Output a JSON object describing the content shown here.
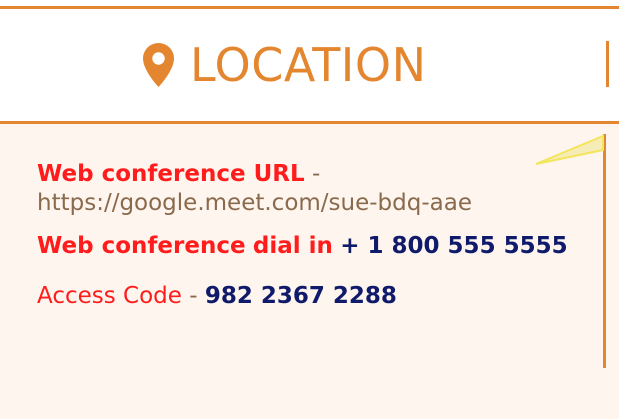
{
  "header": {
    "title": "LOCATION",
    "icon": "map-pin-icon"
  },
  "details": {
    "web_conference_url_label": "Web conference URL",
    "separator_1": " -",
    "web_conference_url_value": "https://google.meet.com/sue-bdq-aae",
    "web_conference_dialin_label": "Web conference",
    "dial_in_label": "dial in",
    "dial_in_value": "+ 1 800 555 5555",
    "access_code_label": "Access Code",
    "separator_2": " - ",
    "access_code_value": "982 2367 2288"
  },
  "colors": {
    "accent": "#e4862f",
    "label_red": "#ff1c1c",
    "value_navy": "#101a6b",
    "url_gray": "#8a6a4d",
    "panel_bg": "#fdf5ee",
    "callout_yellow": "#f3e65c"
  }
}
